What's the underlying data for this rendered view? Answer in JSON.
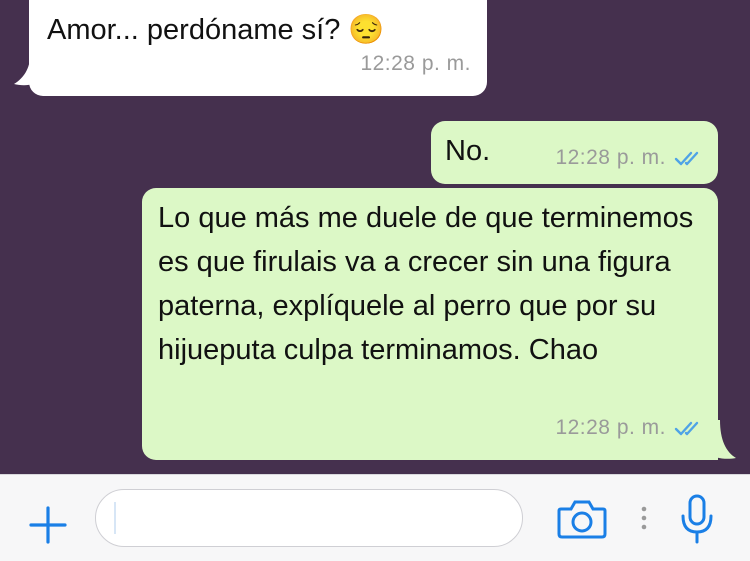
{
  "conversation": {
    "messages": [
      {
        "direction": "incoming",
        "text": "Amor... perdóname sí? 😔",
        "time": "12:28 p. m."
      },
      {
        "direction": "outgoing",
        "text": "No.",
        "time": "12:28 p. m.",
        "status": "read-double-check"
      },
      {
        "direction": "outgoing",
        "text": "Lo que más me duele de que terminemos es que firulais va a crecer sin una figura paterna, explíquele al perro que por su hijueputa culpa terminamos. Chao",
        "time": "12:28 p. m.",
        "status": "read-double-check"
      }
    ]
  },
  "composer": {
    "input_value": "",
    "icons": [
      "plus-icon",
      "camera-icon",
      "more-icon",
      "microphone-icon"
    ]
  },
  "colors": {
    "chat_background": "#45304e",
    "incoming_bubble": "#ffffff",
    "outgoing_bubble": "#dcf8c6",
    "accent": "#1a7fe6",
    "read_receipt": "#4fa3e6"
  }
}
